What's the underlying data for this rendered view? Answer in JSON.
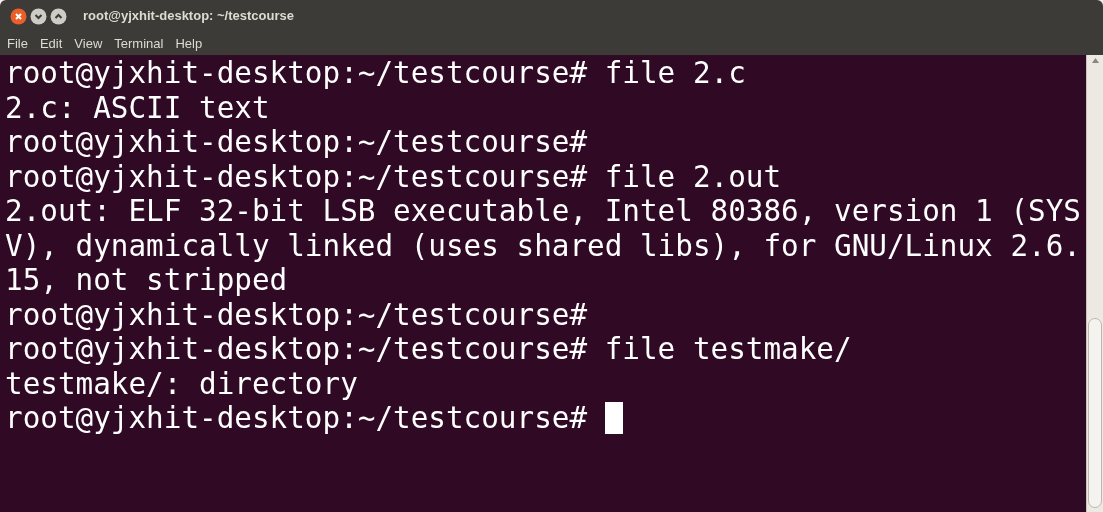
{
  "window": {
    "title": "root@yjxhit-desktop: ~/testcourse"
  },
  "menu": [
    "File",
    "Edit",
    "View",
    "Terminal",
    "Help"
  ],
  "terminal": {
    "lines": [
      "root@yjxhit-desktop:~/testcourse# file 2.c",
      "2.c: ASCII text",
      "root@yjxhit-desktop:~/testcourse#",
      "root@yjxhit-desktop:~/testcourse# file 2.out",
      "2.out: ELF 32-bit LSB executable, Intel 80386, version 1 (SYS",
      "V), dynamically linked (uses shared libs), for GNU/Linux 2.6.",
      "15, not stripped",
      "root@yjxhit-desktop:~/testcourse#",
      "root@yjxhit-desktop:~/testcourse# file testmake/",
      "testmake/: directory",
      "root@yjxhit-desktop:~/testcourse# "
    ],
    "cursor": true
  }
}
